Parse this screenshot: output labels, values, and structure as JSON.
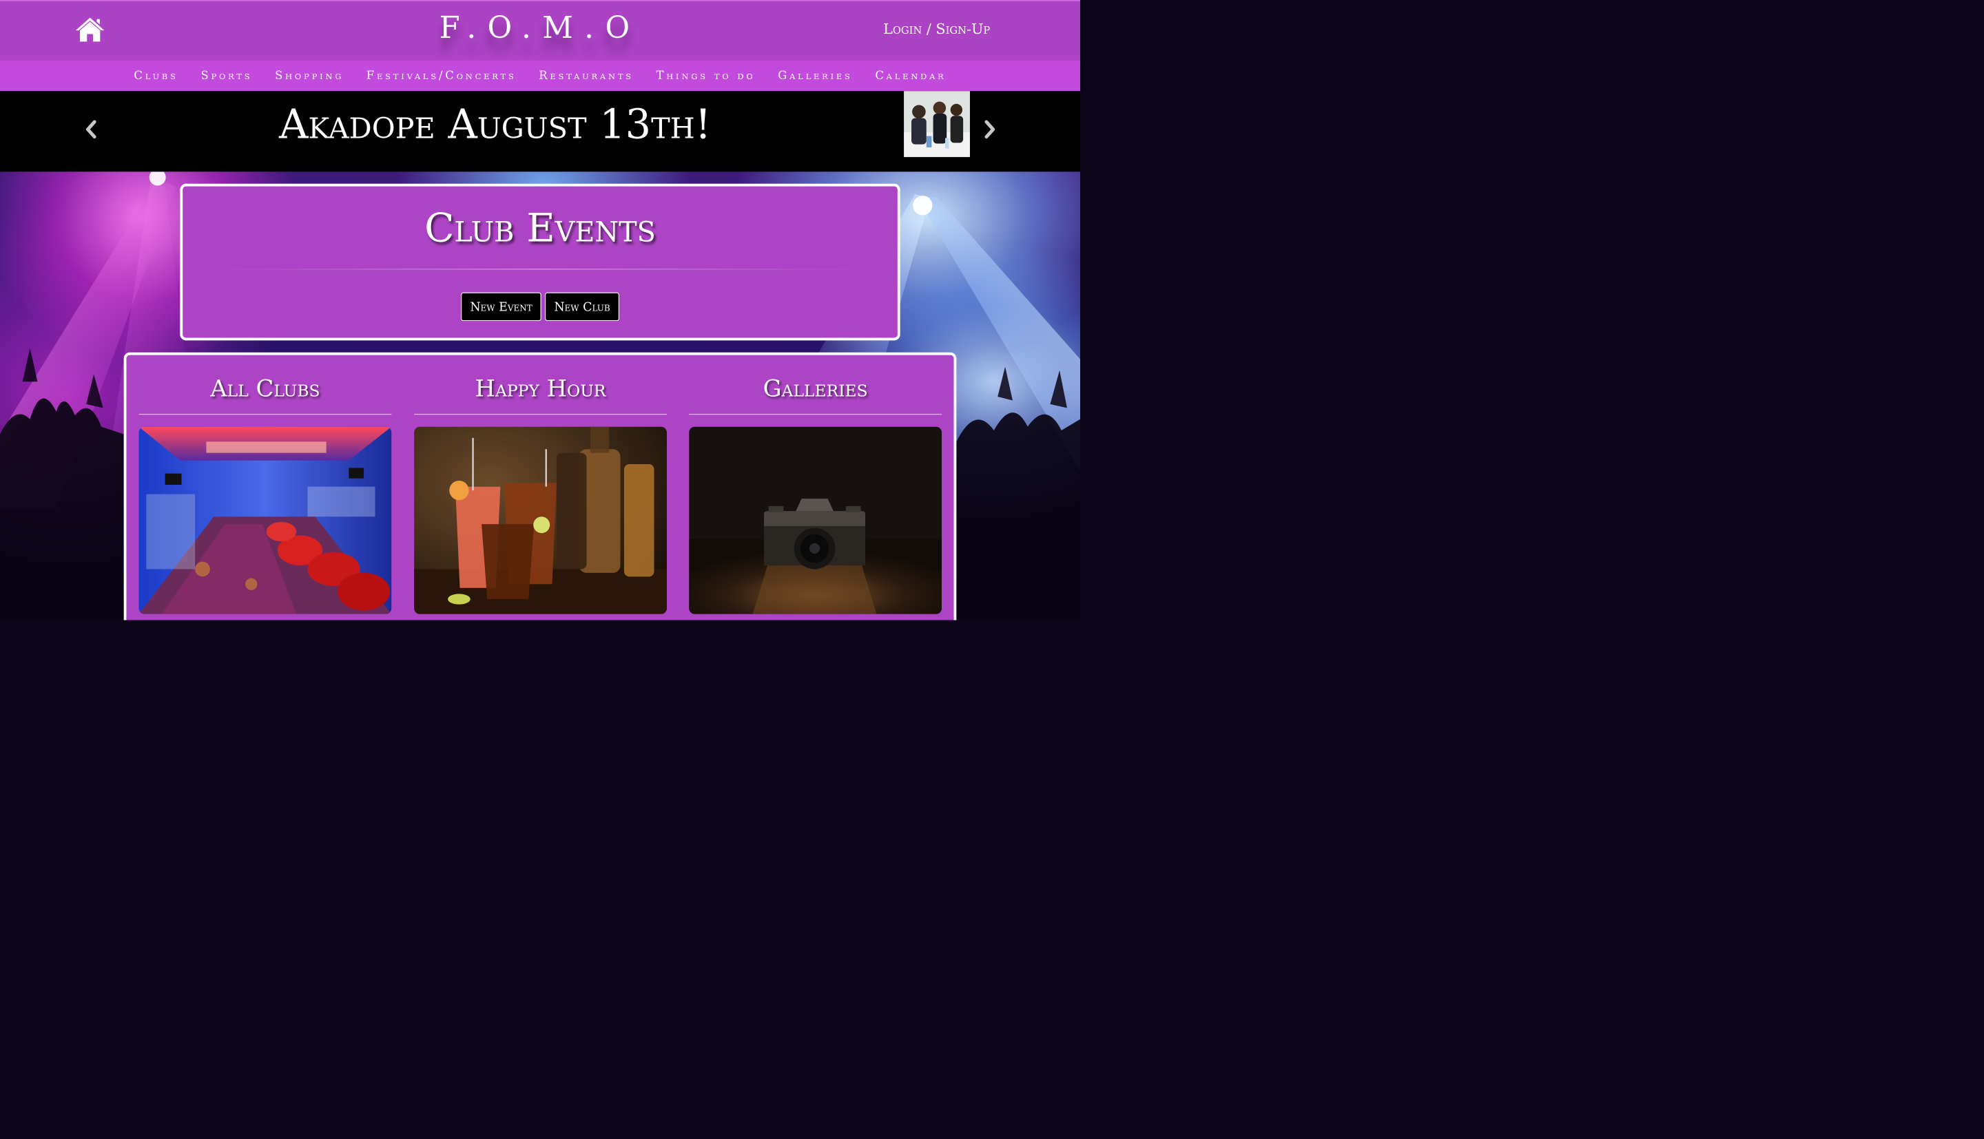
{
  "header": {
    "home_icon": "home-icon",
    "brand": "F.O.M.O",
    "auth_link": "Login / Sign-Up"
  },
  "nav": {
    "items": [
      {
        "label": "Clubs"
      },
      {
        "label": "Sports"
      },
      {
        "label": "Shopping"
      },
      {
        "label": "Festivals/Concerts"
      },
      {
        "label": "Restaurants"
      },
      {
        "label": "Things to do"
      },
      {
        "label": "Galleries"
      },
      {
        "label": "Calendar"
      }
    ]
  },
  "carousel": {
    "title": "Akadope August 13th!",
    "prev_icon": "chevron-left-icon",
    "next_icon": "chevron-right-icon"
  },
  "events": {
    "title": "Club Events",
    "buttons": {
      "new_event": "New Event",
      "new_club": "New Club"
    }
  },
  "categories": [
    {
      "title": "All Clubs"
    },
    {
      "title": "Happy Hour"
    },
    {
      "title": "Galleries"
    }
  ],
  "colors": {
    "header_purple": "#ac42c4",
    "nav_purple": "#c24bde",
    "panel_purple": "#ad44c6",
    "carousel_bg": "#000000",
    "button_bg": "#000000"
  }
}
